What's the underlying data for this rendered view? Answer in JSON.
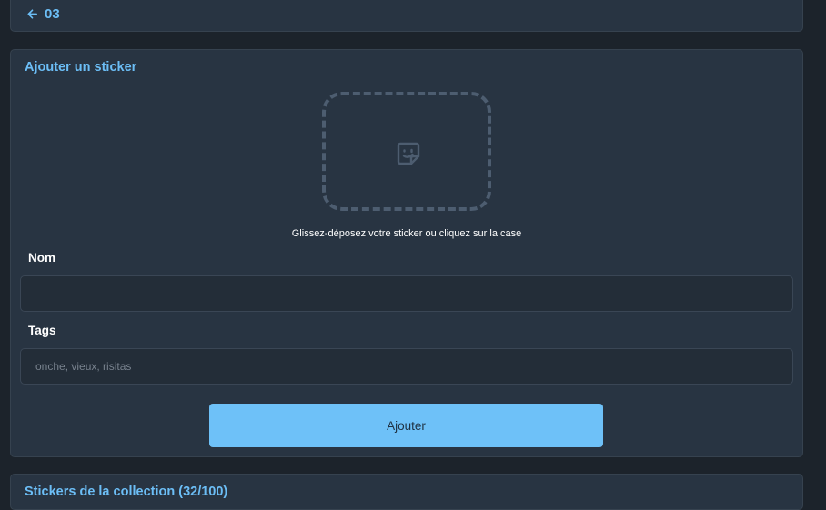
{
  "header": {
    "back_label": "03"
  },
  "add_sticker": {
    "title": "Ajouter un sticker",
    "drop_hint": "Glissez-déposez votre sticker ou cliquez sur la case",
    "name_label": "Nom",
    "name_value": "",
    "tags_label": "Tags",
    "tags_placeholder": "onche, vieux, risitas",
    "submit_label": "Ajouter"
  },
  "collection": {
    "title": "Stickers de la collection (32/100)"
  },
  "colors": {
    "accent": "#6cbef6",
    "background": "#1c232b",
    "card": "#283442",
    "button": "#6ec1f8"
  },
  "icons": {
    "back": "arrow-left-icon",
    "dropzone": "sticker-icon"
  }
}
